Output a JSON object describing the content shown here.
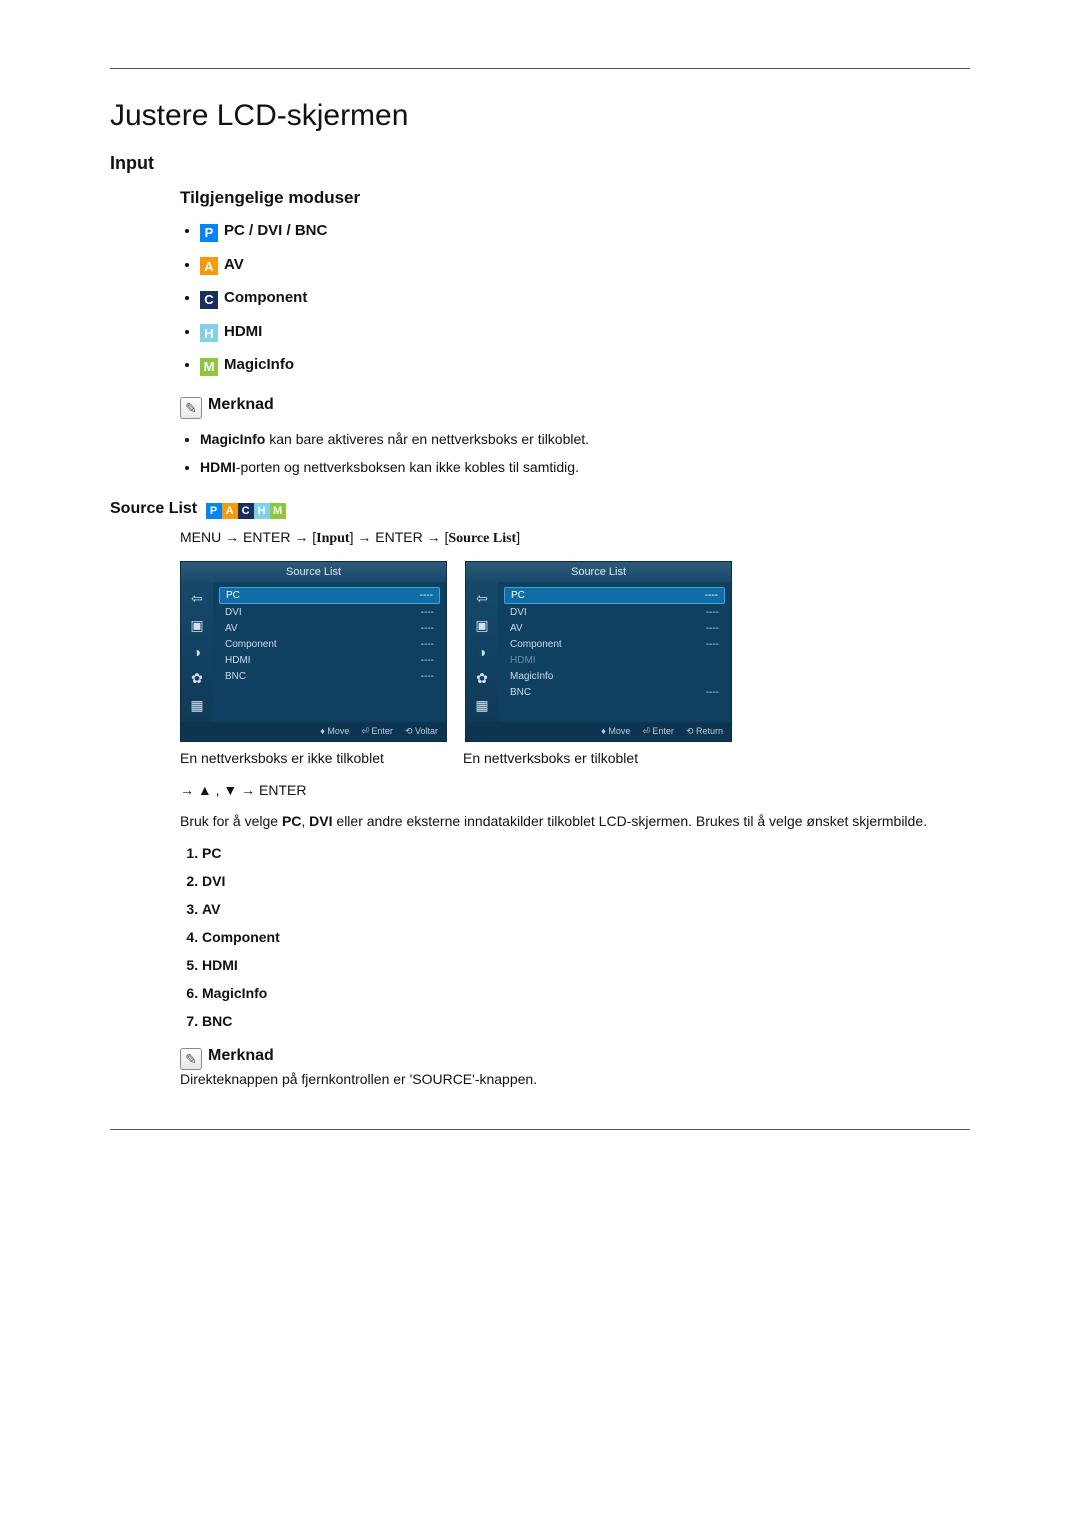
{
  "title": "Justere LCD-skjermen",
  "sections": {
    "input": {
      "heading": "Input",
      "modes_heading": "Tilgjengelige moduser",
      "modes": [
        {
          "badge": "P",
          "cls": "b-p",
          "label": "PC / DVI / BNC"
        },
        {
          "badge": "A",
          "cls": "b-a",
          "label": "AV"
        },
        {
          "badge": "C",
          "cls": "b-c",
          "label": "Component"
        },
        {
          "badge": "H",
          "cls": "b-h",
          "label": "HDMI"
        },
        {
          "badge": "M",
          "cls": "b-m",
          "label": "MagicInfo"
        }
      ],
      "note_label": "Merknad",
      "notes": [
        {
          "bold": "MagicInfo",
          "rest": " kan bare aktiveres når en nettverksboks er tilkoblet."
        },
        {
          "bold": "HDMI",
          "rest": "-porten og nettverksboksen kan ikke kobles til samtidig."
        }
      ]
    },
    "source_list": {
      "heading": "Source List",
      "badges": [
        "P",
        "A",
        "C",
        "H",
        "M"
      ],
      "badge_cls": [
        "b-p",
        "b-a",
        "b-c",
        "b-h",
        "b-m"
      ],
      "path_parts": [
        "MENU → ENTER → [",
        "Input",
        "] → ENTER → [",
        "Source List",
        "]"
      ],
      "osd_title": "Source List",
      "osd1": {
        "rows": [
          {
            "l": "PC",
            "r": "----",
            "sel": true
          },
          {
            "l": "DVI",
            "r": "----"
          },
          {
            "l": "AV",
            "r": "----"
          },
          {
            "l": "Component",
            "r": "----"
          },
          {
            "l": "HDMI",
            "r": "----"
          },
          {
            "l": "BNC",
            "r": "----"
          }
        ],
        "footer": [
          "♦ Move",
          "⏎ Enter",
          "⟲ Voltar"
        ],
        "caption": "En nettverksboks er ikke tilkoblet"
      },
      "osd2": {
        "rows": [
          {
            "l": "PC",
            "r": "----",
            "sel": true
          },
          {
            "l": "DVI",
            "r": "----"
          },
          {
            "l": "AV",
            "r": "----"
          },
          {
            "l": "Component",
            "r": "----"
          },
          {
            "l": "HDMI",
            "r": "",
            "dim": true
          },
          {
            "l": "MagicInfo",
            "r": ""
          },
          {
            "l": "BNC",
            "r": "----"
          }
        ],
        "footer": [
          "♦ Move",
          "⏎ Enter",
          "⟲ Return"
        ],
        "caption": "En nettverksboks er tilkoblet"
      },
      "nav_line": "→ ▲ , ▼ → ENTER",
      "body_pre": "Bruk for å velge ",
      "body_b1": "PC",
      "body_mid1": ", ",
      "body_b2": "DVI",
      "body_post": " eller andre eksterne inndatakilder tilkoblet LCD-skjermen. Brukes til å velge ønsket skjermbilde.",
      "numlist": [
        "PC",
        "DVI",
        "AV",
        "Component",
        "HDMI",
        "MagicInfo",
        "BNC"
      ],
      "note2_label": "Merknad",
      "note2_text": "Direkteknappen på fjernkontrollen er 'SOURCE'-knappen."
    }
  }
}
